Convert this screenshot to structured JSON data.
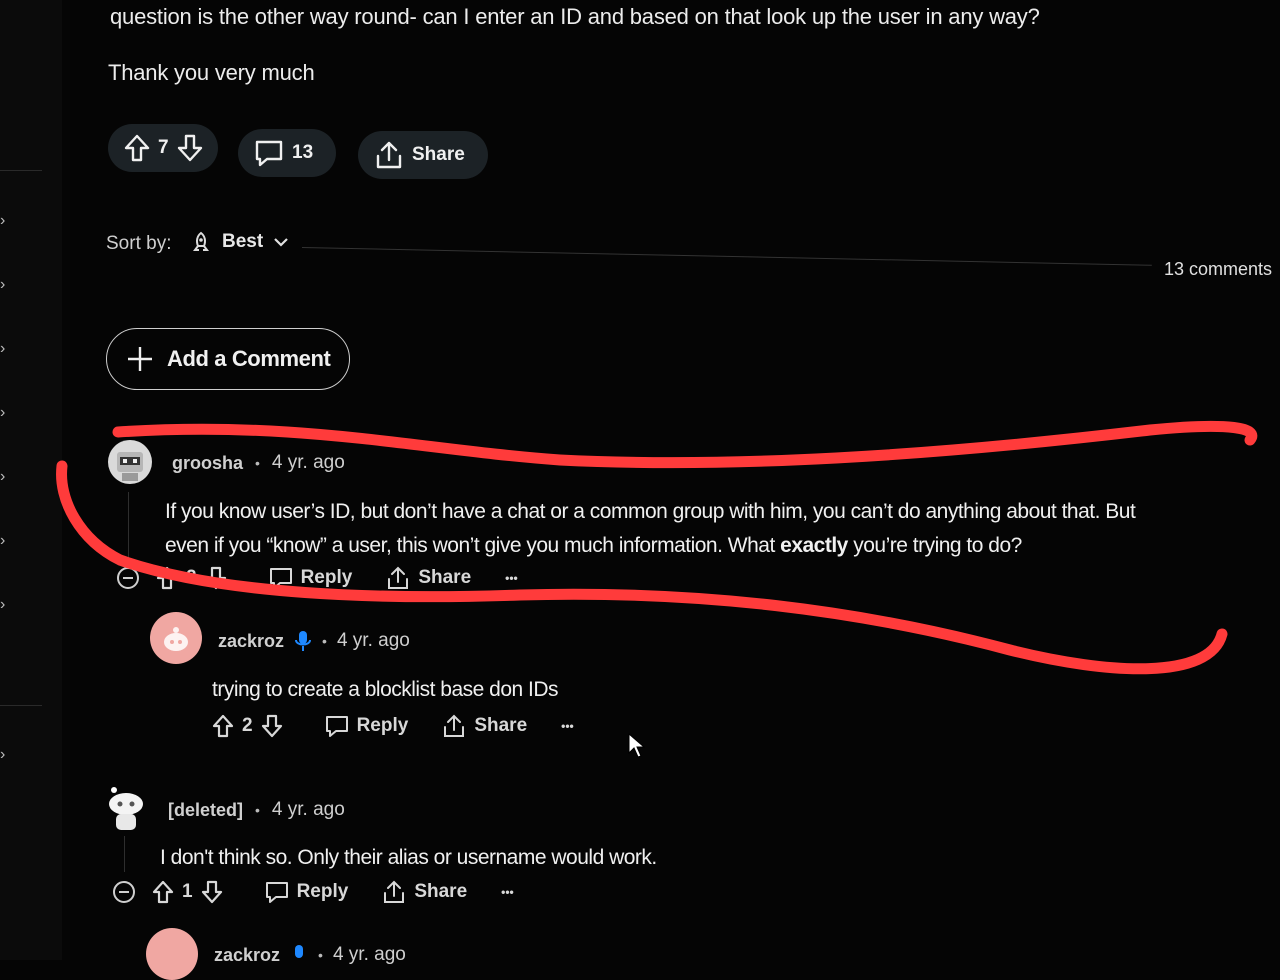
{
  "post": {
    "line1": "question is the other way round- can I enter an ID and based on that look up the user in any way?",
    "line2": "Thank you very much",
    "votes": "7",
    "comments": "13",
    "share_label": "Share"
  },
  "sort": {
    "label": "Sort by:",
    "value": "Best"
  },
  "comment_count": "13 comments",
  "add_comment_label": "Add a Comment",
  "comments": [
    {
      "user": "groosha",
      "time": "4 yr. ago",
      "text1": "If you know user’s ID, but don’t have a chat or a common group with him, you can’t do anything about that. But",
      "text2_a": "even if you “know” a user, this won’t give you much information. What ",
      "text2_b": "exactly",
      "text2_c": " you’re trying to do?",
      "votes": "2",
      "reply_label": "Reply",
      "share_label": "Share",
      "more_label": "•••"
    },
    {
      "user": "zackroz",
      "time": "4 yr. ago",
      "text": "trying to create a blocklist base don IDs",
      "votes": "2",
      "reply_label": "Reply",
      "share_label": "Share",
      "more_label": "•••"
    },
    {
      "user": "[deleted]",
      "time": "4 yr. ago",
      "text": "I don't think so. Only their alias or username would work.",
      "votes": "1",
      "reply_label": "Reply",
      "share_label": "Share",
      "more_label": "•••"
    },
    {
      "user": "zackroz",
      "time": "4 yr. ago"
    }
  ],
  "colors": {
    "accent_red": "#ff3b3b",
    "pill_bg": "#1c2226",
    "background": "#050505"
  }
}
